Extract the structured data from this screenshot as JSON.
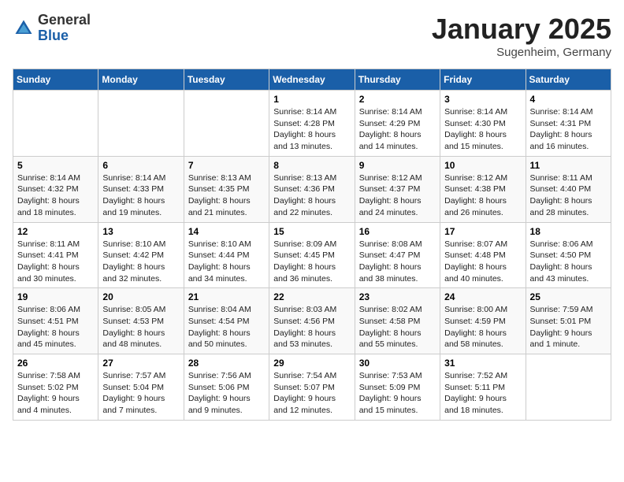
{
  "header": {
    "logo_general": "General",
    "logo_blue": "Blue",
    "month": "January 2025",
    "location": "Sugenheim, Germany"
  },
  "weekdays": [
    "Sunday",
    "Monday",
    "Tuesday",
    "Wednesday",
    "Thursday",
    "Friday",
    "Saturday"
  ],
  "weeks": [
    [
      {
        "day": "",
        "info": ""
      },
      {
        "day": "",
        "info": ""
      },
      {
        "day": "",
        "info": ""
      },
      {
        "day": "1",
        "info": "Sunrise: 8:14 AM\nSunset: 4:28 PM\nDaylight: 8 hours\nand 13 minutes."
      },
      {
        "day": "2",
        "info": "Sunrise: 8:14 AM\nSunset: 4:29 PM\nDaylight: 8 hours\nand 14 minutes."
      },
      {
        "day": "3",
        "info": "Sunrise: 8:14 AM\nSunset: 4:30 PM\nDaylight: 8 hours\nand 15 minutes."
      },
      {
        "day": "4",
        "info": "Sunrise: 8:14 AM\nSunset: 4:31 PM\nDaylight: 8 hours\nand 16 minutes."
      }
    ],
    [
      {
        "day": "5",
        "info": "Sunrise: 8:14 AM\nSunset: 4:32 PM\nDaylight: 8 hours\nand 18 minutes."
      },
      {
        "day": "6",
        "info": "Sunrise: 8:14 AM\nSunset: 4:33 PM\nDaylight: 8 hours\nand 19 minutes."
      },
      {
        "day": "7",
        "info": "Sunrise: 8:13 AM\nSunset: 4:35 PM\nDaylight: 8 hours\nand 21 minutes."
      },
      {
        "day": "8",
        "info": "Sunrise: 8:13 AM\nSunset: 4:36 PM\nDaylight: 8 hours\nand 22 minutes."
      },
      {
        "day": "9",
        "info": "Sunrise: 8:12 AM\nSunset: 4:37 PM\nDaylight: 8 hours\nand 24 minutes."
      },
      {
        "day": "10",
        "info": "Sunrise: 8:12 AM\nSunset: 4:38 PM\nDaylight: 8 hours\nand 26 minutes."
      },
      {
        "day": "11",
        "info": "Sunrise: 8:11 AM\nSunset: 4:40 PM\nDaylight: 8 hours\nand 28 minutes."
      }
    ],
    [
      {
        "day": "12",
        "info": "Sunrise: 8:11 AM\nSunset: 4:41 PM\nDaylight: 8 hours\nand 30 minutes."
      },
      {
        "day": "13",
        "info": "Sunrise: 8:10 AM\nSunset: 4:42 PM\nDaylight: 8 hours\nand 32 minutes."
      },
      {
        "day": "14",
        "info": "Sunrise: 8:10 AM\nSunset: 4:44 PM\nDaylight: 8 hours\nand 34 minutes."
      },
      {
        "day": "15",
        "info": "Sunrise: 8:09 AM\nSunset: 4:45 PM\nDaylight: 8 hours\nand 36 minutes."
      },
      {
        "day": "16",
        "info": "Sunrise: 8:08 AM\nSunset: 4:47 PM\nDaylight: 8 hours\nand 38 minutes."
      },
      {
        "day": "17",
        "info": "Sunrise: 8:07 AM\nSunset: 4:48 PM\nDaylight: 8 hours\nand 40 minutes."
      },
      {
        "day": "18",
        "info": "Sunrise: 8:06 AM\nSunset: 4:50 PM\nDaylight: 8 hours\nand 43 minutes."
      }
    ],
    [
      {
        "day": "19",
        "info": "Sunrise: 8:06 AM\nSunset: 4:51 PM\nDaylight: 8 hours\nand 45 minutes."
      },
      {
        "day": "20",
        "info": "Sunrise: 8:05 AM\nSunset: 4:53 PM\nDaylight: 8 hours\nand 48 minutes."
      },
      {
        "day": "21",
        "info": "Sunrise: 8:04 AM\nSunset: 4:54 PM\nDaylight: 8 hours\nand 50 minutes."
      },
      {
        "day": "22",
        "info": "Sunrise: 8:03 AM\nSunset: 4:56 PM\nDaylight: 8 hours\nand 53 minutes."
      },
      {
        "day": "23",
        "info": "Sunrise: 8:02 AM\nSunset: 4:58 PM\nDaylight: 8 hours\nand 55 minutes."
      },
      {
        "day": "24",
        "info": "Sunrise: 8:00 AM\nSunset: 4:59 PM\nDaylight: 8 hours\nand 58 minutes."
      },
      {
        "day": "25",
        "info": "Sunrise: 7:59 AM\nSunset: 5:01 PM\nDaylight: 9 hours\nand 1 minute."
      }
    ],
    [
      {
        "day": "26",
        "info": "Sunrise: 7:58 AM\nSunset: 5:02 PM\nDaylight: 9 hours\nand 4 minutes."
      },
      {
        "day": "27",
        "info": "Sunrise: 7:57 AM\nSunset: 5:04 PM\nDaylight: 9 hours\nand 7 minutes."
      },
      {
        "day": "28",
        "info": "Sunrise: 7:56 AM\nSunset: 5:06 PM\nDaylight: 9 hours\nand 9 minutes."
      },
      {
        "day": "29",
        "info": "Sunrise: 7:54 AM\nSunset: 5:07 PM\nDaylight: 9 hours\nand 12 minutes."
      },
      {
        "day": "30",
        "info": "Sunrise: 7:53 AM\nSunset: 5:09 PM\nDaylight: 9 hours\nand 15 minutes."
      },
      {
        "day": "31",
        "info": "Sunrise: 7:52 AM\nSunset: 5:11 PM\nDaylight: 9 hours\nand 18 minutes."
      },
      {
        "day": "",
        "info": ""
      }
    ]
  ]
}
